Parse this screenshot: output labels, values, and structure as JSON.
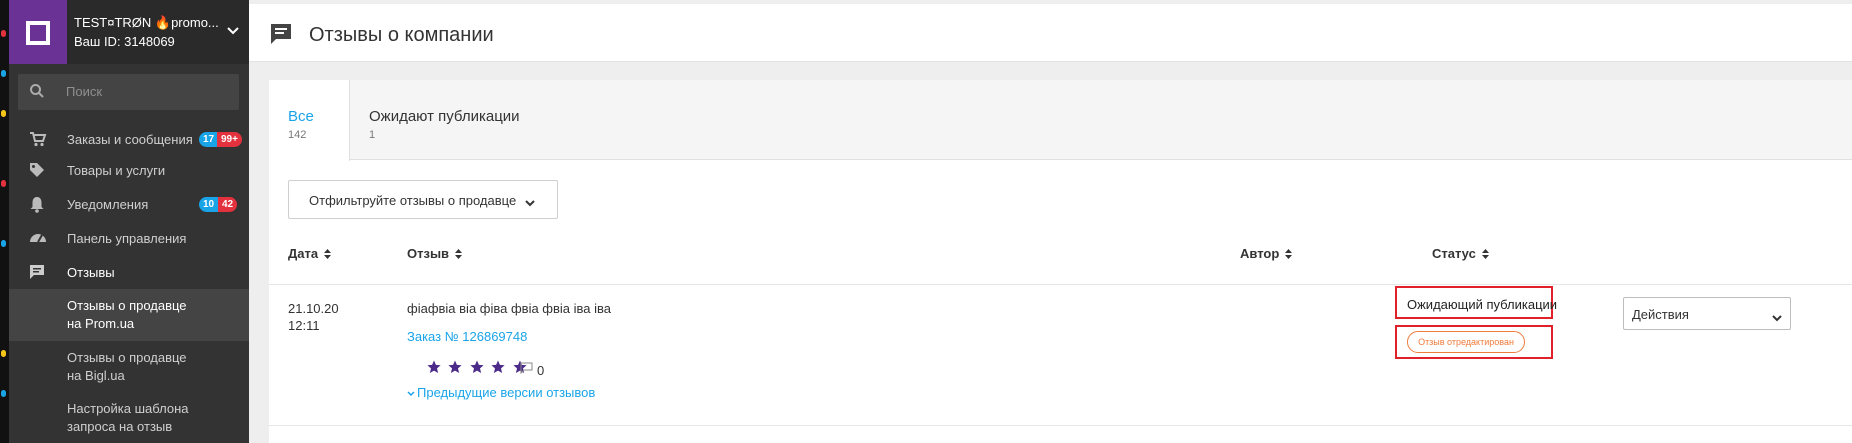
{
  "account": {
    "name": "TEST¤TRØN 🔥promo...",
    "id_label": "Ваш ID: 3148069"
  },
  "search": {
    "placeholder": "Поиск"
  },
  "nav": {
    "orders": {
      "label": "Заказы и сообщения",
      "badge_blue": "17",
      "badge_red": "99+"
    },
    "products": {
      "label": "Товары и услуги"
    },
    "notifications": {
      "label": "Уведомления",
      "badge_blue": "10",
      "badge_red": "42"
    },
    "dashboard": {
      "label": "Панель управления"
    },
    "reviews": {
      "label": "Отзывы"
    },
    "sub": [
      {
        "line1": "Отзывы о продавце",
        "line2": "на Prom.ua"
      },
      {
        "line1": "Отзывы о продавце",
        "line2": "на Bigl.ua"
      },
      {
        "line1": "Настройка шаблона",
        "line2": "запроса на отзыв"
      }
    ]
  },
  "page": {
    "title": "Отзывы о компании"
  },
  "tabs": [
    {
      "label": "Все",
      "count": "142"
    },
    {
      "label": "Ожидают публикации",
      "count": "1"
    }
  ],
  "filter": {
    "label": "Отфильтруйте отзывы о продавце"
  },
  "table": {
    "headers": {
      "date": "Дата",
      "review": "Отзыв",
      "author": "Автор",
      "status": "Статус"
    },
    "row": {
      "date": "21.10.20",
      "time": "12:11",
      "text": "фіафвіа віа фіва фвіа фвіа іва іва",
      "order_link": "Заказ № 126869748",
      "rating": 5,
      "comments": "0",
      "prev_versions": "Предыдущие версии отзывов",
      "status": "Ожидающий публикации",
      "edited": "Отзыв отредактирован",
      "actions": "Действия"
    }
  },
  "colors": {
    "accent": "#1aa4e8",
    "brand": "#6a3295",
    "star": "#4b2a8a",
    "highlight": "#e0202a",
    "edited": "#f07c3c",
    "badge_blue": "#1aa4e8",
    "badge_red": "#e3323e"
  }
}
